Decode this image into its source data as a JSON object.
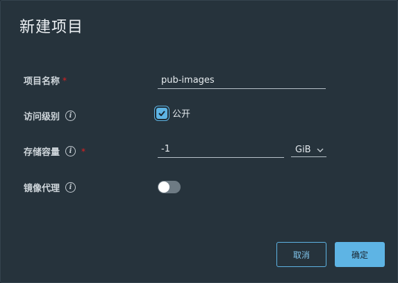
{
  "dialog": {
    "title": "新建项目"
  },
  "fields": {
    "project_name": {
      "label": "项目名称",
      "required_mark": "*",
      "value": "pub-images"
    },
    "access_level": {
      "label": "访问级别",
      "checkbox_label": "公开",
      "checked": true
    },
    "storage_quota": {
      "label": "存储容量",
      "required_mark": "*",
      "value": "-1",
      "unit": "GiB"
    },
    "proxy_cache": {
      "label": "镜像代理",
      "enabled": false
    }
  },
  "info_icon_glyph": "i",
  "buttons": {
    "cancel": "取消",
    "confirm": "确定"
  },
  "colors": {
    "accent": "#5eb4e4",
    "required": "#e02020",
    "background": "#26333c"
  }
}
